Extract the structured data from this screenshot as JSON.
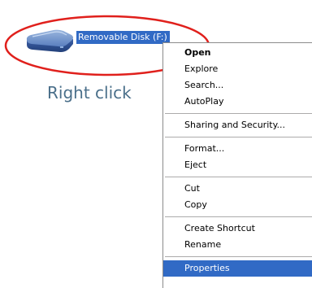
{
  "desktop": {
    "drive_label": "Removable Disk (F:)",
    "drive_icon": "removable-disk-icon"
  },
  "annotation": {
    "caption": "Right click",
    "highlight_color": "#e0201c",
    "caption_color": "#4a6f8a"
  },
  "context_menu": {
    "open": "Open",
    "explore": "Explore",
    "search": "Search...",
    "autoplay": "AutoPlay",
    "sharing_security": "Sharing and Security...",
    "format": "Format...",
    "eject": "Eject",
    "cut": "Cut",
    "copy": "Copy",
    "create_shortcut": "Create Shortcut",
    "rename": "Rename",
    "properties": "Properties",
    "selection_color": "#316ac5"
  }
}
